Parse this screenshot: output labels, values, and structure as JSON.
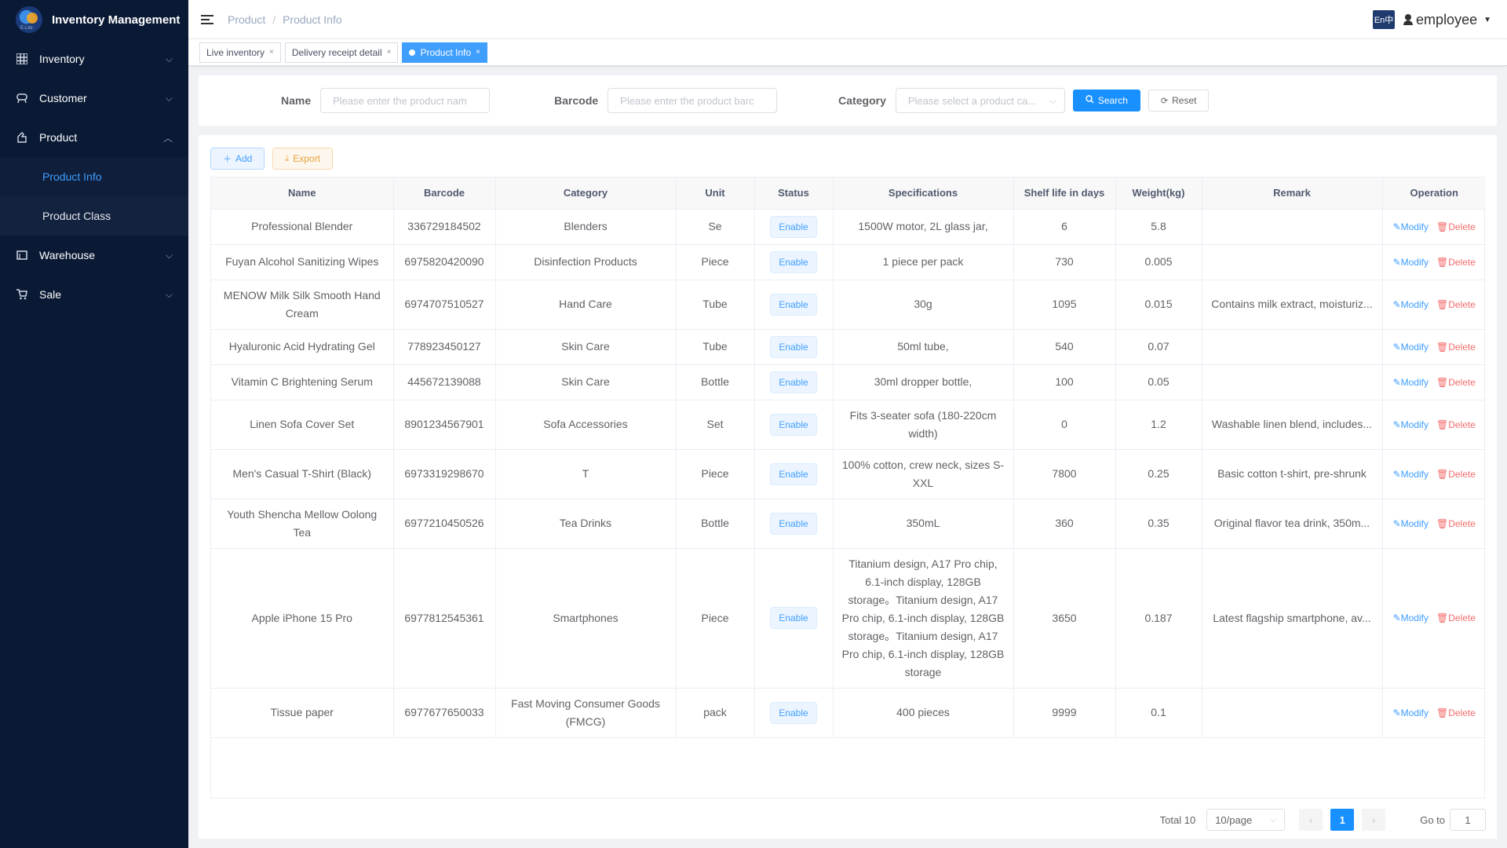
{
  "app": {
    "title": "Inventory Management",
    "logo_sub": "E-Lite"
  },
  "sidebar": {
    "items": [
      {
        "label": "Inventory",
        "icon": "grid-icon"
      },
      {
        "label": "Customer",
        "icon": "customer-icon"
      },
      {
        "label": "Product",
        "icon": "product-icon"
      },
      {
        "label": "Warehouse",
        "icon": "warehouse-icon"
      },
      {
        "label": "Sale",
        "icon": "cart-icon"
      }
    ],
    "product_sub": [
      {
        "label": "Product Info",
        "active": true
      },
      {
        "label": "Product Class",
        "active": false
      }
    ]
  },
  "header": {
    "breadcrumb": [
      "Product",
      "Product Info"
    ],
    "lang": "En中",
    "user": "employee"
  },
  "tags": [
    {
      "label": "Live inventory"
    },
    {
      "label": "Delivery receipt detail"
    },
    {
      "label": "Product Info",
      "active": true
    }
  ],
  "search": {
    "name_label": "Name",
    "name_placeholder": "Please enter the product nam",
    "barcode_label": "Barcode",
    "barcode_placeholder": "Please enter the product barc",
    "category_label": "Category",
    "category_placeholder": "Please select a product ca...",
    "search_btn": "Search",
    "reset_btn": "Reset"
  },
  "toolbar": {
    "add": "Add",
    "export": "Export"
  },
  "table": {
    "headers": [
      "Name",
      "Barcode",
      "Category",
      "Unit",
      "Status",
      "Specifications",
      "Shelf life in days",
      "Weight(kg)",
      "Remark",
      "Operation"
    ],
    "modify_label": "Modify",
    "delete_label": "Delete",
    "rows": [
      {
        "name": "Professional Blender",
        "barcode": "336729184502",
        "category": "Blenders",
        "unit": "Se",
        "status": "Enable",
        "spec": "1500W motor, 2L glass jar,",
        "shelf": "6",
        "weight": "5.8",
        "remark": ""
      },
      {
        "name": "Fuyan Alcohol Sanitizing Wipes",
        "barcode": "6975820420090",
        "category": "Disinfection Products",
        "unit": "Piece",
        "status": "Enable",
        "spec": "1 piece per pack",
        "shelf": "730",
        "weight": "0.005",
        "remark": ""
      },
      {
        "name": "MENOW Milk Silk Smooth Hand Cream",
        "barcode": "6974707510527",
        "category": "Hand Care",
        "unit": "Tube",
        "status": "Enable",
        "spec": "30g",
        "shelf": "1095",
        "weight": "0.015",
        "remark": "Contains milk extract, moisturiz..."
      },
      {
        "name": "Hyaluronic Acid Hydrating Gel",
        "barcode": "778923450127",
        "category": "Skin Care",
        "unit": "Tube",
        "status": "Enable",
        "spec": "50ml tube,",
        "shelf": "540",
        "weight": "0.07",
        "remark": ""
      },
      {
        "name": "Vitamin C Brightening Serum",
        "barcode": "445672139088",
        "category": "Skin Care",
        "unit": "Bottle",
        "status": "Enable",
        "spec": "30ml dropper bottle,",
        "shelf": "100",
        "weight": "0.05",
        "remark": ""
      },
      {
        "name": "Linen Sofa Cover Set",
        "barcode": "8901234567901",
        "category": "Sofa Accessories",
        "unit": "Set",
        "status": "Enable",
        "spec": "Fits 3-seater sofa (180-220cm width)",
        "shelf": "0",
        "weight": "1.2",
        "remark": "Washable linen blend, includes..."
      },
      {
        "name": "Men's Casual T-Shirt (Black)",
        "barcode": "6973319298670",
        "category": "T",
        "unit": "Piece",
        "status": "Enable",
        "spec": "100% cotton, crew neck, sizes S-XXL",
        "shelf": "7800",
        "weight": "0.25",
        "remark": "Basic cotton t-shirt, pre-shrunk"
      },
      {
        "name": "Youth Shencha Mellow Oolong Tea",
        "barcode": "6977210450526",
        "category": "Tea Drinks",
        "unit": "Bottle",
        "status": "Enable",
        "spec": "350mL",
        "shelf": "360",
        "weight": "0.35",
        "remark": "Original flavor tea drink, 350m..."
      },
      {
        "name": "Apple iPhone 15 Pro",
        "barcode": "6977812545361",
        "category": "Smartphones",
        "unit": "Piece",
        "status": "Enable",
        "spec": "Titanium design, A17 Pro chip, 6.1-inch display, 128GB storage。Titanium design, A17 Pro chip, 6.1-inch display, 128GB storage。Titanium design, A17 Pro chip, 6.1-inch display, 128GB storage",
        "shelf": "3650",
        "weight": "0.187",
        "remark": "Latest flagship smartphone, av..."
      },
      {
        "name": "Tissue paper",
        "barcode": "6977677650033",
        "category": "Fast Moving Consumer Goods (FMCG)",
        "unit": "pack",
        "status": "Enable",
        "spec": "400 pieces",
        "shelf": "9999",
        "weight": "0.1",
        "remark": ""
      }
    ]
  },
  "pagination": {
    "total": "Total 10",
    "page_size": "10/page",
    "current": "1",
    "goto_label": "Go to",
    "goto_value": "1"
  },
  "colors": {
    "sidebar_bg": "#0a1a35",
    "primary": "#1890ff",
    "danger": "#f56c6c"
  }
}
